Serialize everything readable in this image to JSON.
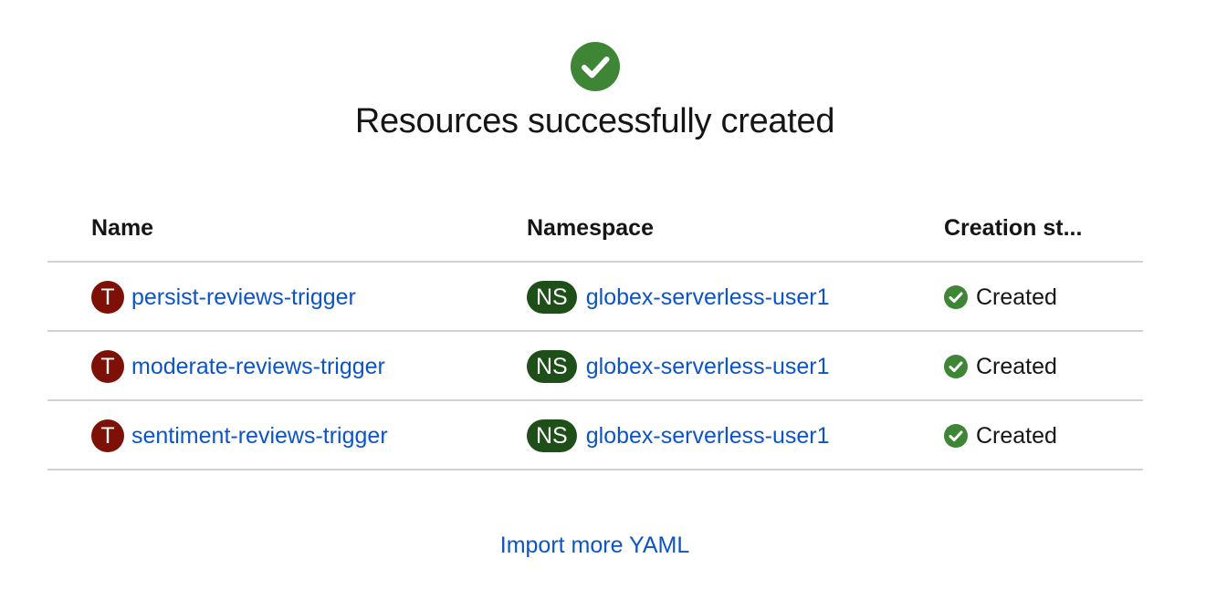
{
  "title": "Resources successfully created",
  "icons": {
    "success": "check-circle-icon",
    "status": "check-circle-icon"
  },
  "colors": {
    "success": "#3e8635",
    "trigger_badge": "#7d1007",
    "namespace_badge": "#1e4f18",
    "link": "#0b55c7",
    "divider": "#d2d2d2"
  },
  "table": {
    "headers": {
      "name": "Name",
      "namespace": "Namespace",
      "status": "Creation st..."
    },
    "rows": [
      {
        "badge": "T",
        "name": "persist-reviews-trigger",
        "ns_badge": "NS",
        "namespace": "globex-serverless-user1",
        "status": "Created"
      },
      {
        "badge": "T",
        "name": "moderate-reviews-trigger",
        "ns_badge": "NS",
        "namespace": "globex-serverless-user1",
        "status": "Created"
      },
      {
        "badge": "T",
        "name": "sentiment-reviews-trigger",
        "ns_badge": "NS",
        "namespace": "globex-serverless-user1",
        "status": "Created"
      }
    ]
  },
  "import_link": "Import more YAML"
}
